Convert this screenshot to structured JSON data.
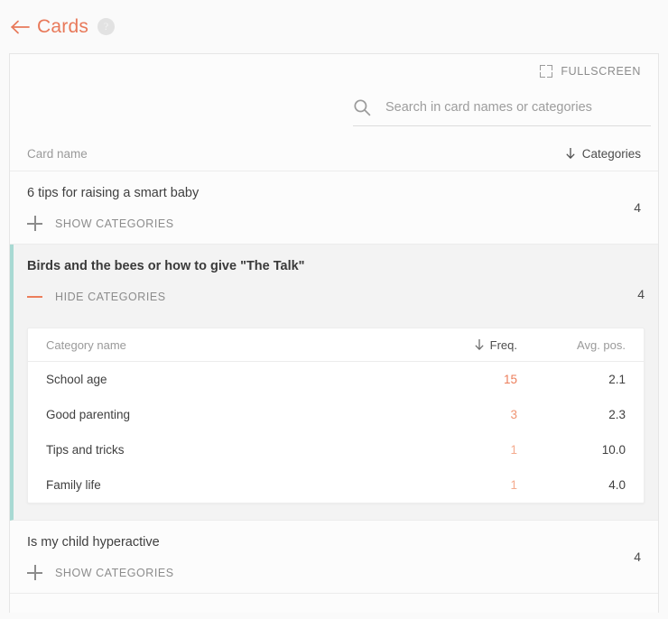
{
  "header": {
    "back_icon": "back-arrow-icon",
    "title": "Cards",
    "help_icon_label": "?"
  },
  "toolbar": {
    "fullscreen_label": "FULLSCREEN",
    "fullscreen_icon": "fullscreen-icon"
  },
  "search": {
    "placeholder": "Search in card names or categories",
    "value": "",
    "icon": "search-icon"
  },
  "table": {
    "columns": {
      "card_name": "Card name",
      "categories": "Categories",
      "sort_icon": "sort-descending-arrow-icon"
    },
    "rows": [
      {
        "title": "6 tips for raising a smart baby",
        "count": "4",
        "expanded": false,
        "toggle_label": "SHOW CATEGORIES",
        "toggle_icon": "plus-icon"
      },
      {
        "title": "Birds and the bees or how to give \"The Talk\"",
        "count": "4",
        "expanded": true,
        "toggle_label": "HIDE CATEGORIES",
        "toggle_icon": "minus-icon",
        "subtable": {
          "columns": {
            "name": "Category name",
            "freq": "Freq.",
            "pos": "Avg. pos.",
            "sort_icon": "sort-descending-arrow-icon"
          },
          "rows": [
            {
              "name": "School age",
              "freq": "15",
              "pos": "2.1",
              "freq_weight": 1.0
            },
            {
              "name": "Good parenting",
              "freq": "3",
              "pos": "2.3",
              "freq_weight": 0.72
            },
            {
              "name": "Tips and tricks",
              "freq": "1",
              "pos": "10.0",
              "freq_weight": 0.55
            },
            {
              "name": "Family life",
              "freq": "1",
              "pos": "4.0",
              "freq_weight": 0.55
            }
          ]
        }
      },
      {
        "title": "Is my child hyperactive",
        "count": "4",
        "expanded": false,
        "toggle_label": "SHOW CATEGORIES",
        "toggle_icon": "plus-icon"
      }
    ]
  },
  "colors": {
    "accent": "#e8795a",
    "freq_accent": "#ec7e5b",
    "expanded_border": "#a8d9d3",
    "page_bg": "#fafafa",
    "panel_bg": "#fcfcfc",
    "expanded_bg": "#f3f3f3"
  }
}
